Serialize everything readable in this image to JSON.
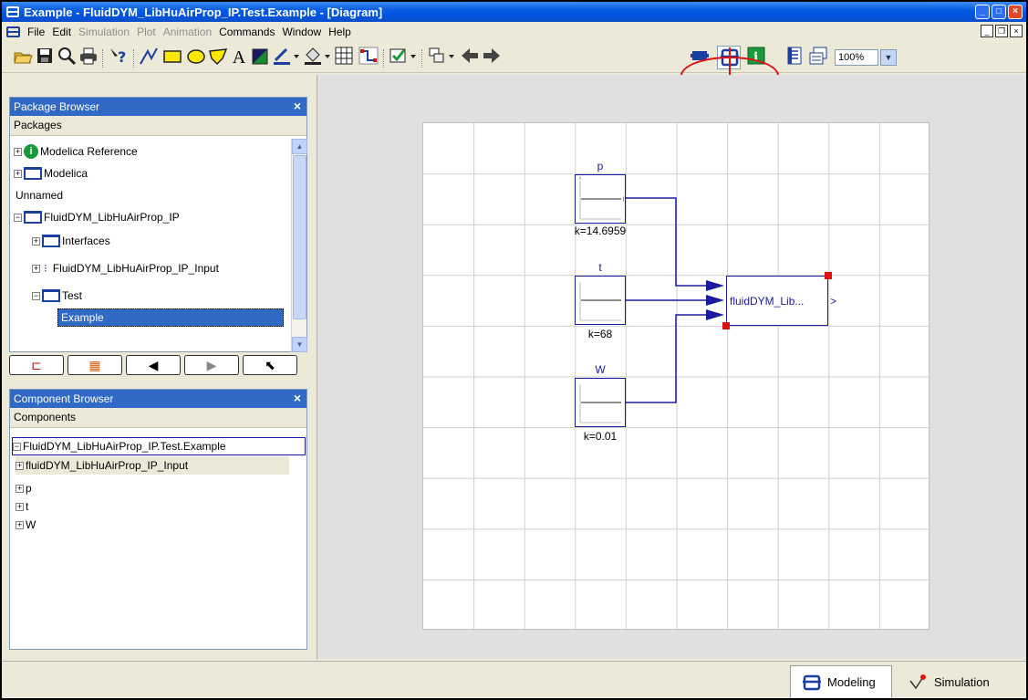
{
  "window": {
    "title": "Example - FluidDYM_LibHuAirProp_IP.Test.Example  - [Diagram]"
  },
  "menu": {
    "items": [
      {
        "label": "File",
        "enabled": true
      },
      {
        "label": "Edit",
        "enabled": true
      },
      {
        "label": "Simulation",
        "enabled": false
      },
      {
        "label": "Plot",
        "enabled": false
      },
      {
        "label": "Animation",
        "enabled": false
      },
      {
        "label": "Commands",
        "enabled": true
      },
      {
        "label": "Window",
        "enabled": true
      },
      {
        "label": "Help",
        "enabled": true
      }
    ]
  },
  "toolbar": {
    "zoom": "100%",
    "text_tool": "A"
  },
  "package_browser": {
    "title": "Package Browser",
    "header": "Packages",
    "items": [
      {
        "label": "Modelica Reference"
      },
      {
        "label": "Modelica"
      },
      {
        "label": "Unnamed"
      },
      {
        "label": "FluidDYM_LibHuAirProp_IP"
      },
      {
        "label": "Interfaces"
      },
      {
        "label": "FluidDYM_LibHuAirProp_IP_Input"
      },
      {
        "label": "Test"
      },
      {
        "label": "Example"
      }
    ]
  },
  "component_browser": {
    "title": "Component Browser",
    "header": "Components",
    "root": "FluidDYM_LibHuAirProp_IP.Test.Example",
    "items": [
      {
        "label": "fluidDYM_LibHuAirProp_IP_Input"
      },
      {
        "label": "p"
      },
      {
        "label": "t"
      },
      {
        "label": "W"
      }
    ]
  },
  "diagram": {
    "blocks": [
      {
        "name": "p",
        "param": "k=14.6959"
      },
      {
        "name": "t",
        "param": "k=68"
      },
      {
        "name": "W",
        "param": "k=0.01"
      }
    ],
    "main_block": {
      "label": "fluidDYM_Lib..."
    }
  },
  "mode_tabs": {
    "modeling": "Modeling",
    "simulation": "Simulation"
  },
  "colors": {
    "selection": "#3169c6",
    "diagram_blue": "#1a1aa0",
    "highlight_red": "#e01010"
  }
}
